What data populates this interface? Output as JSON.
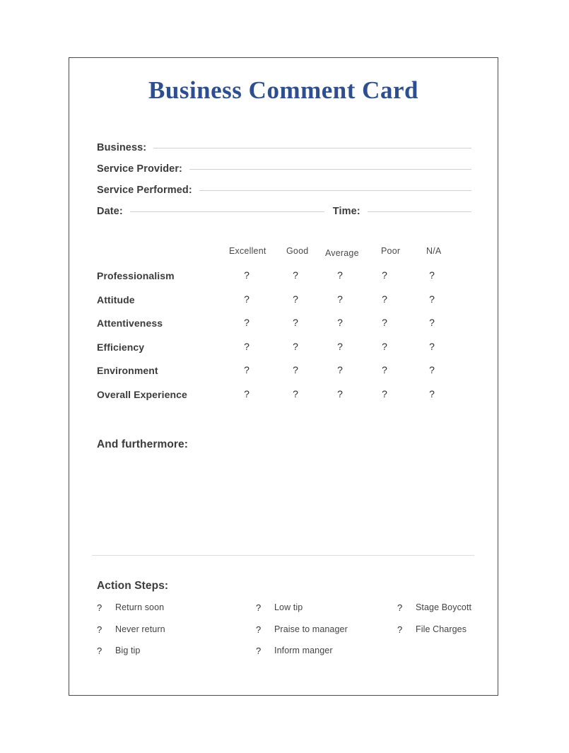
{
  "document": {
    "title": "Business Comment Card",
    "title_color": "#2e4f8f",
    "border_color": "#4a4a4a",
    "line_color": "#d2d2d2"
  },
  "form_fields": [
    {
      "label": "Business:"
    },
    {
      "label": "Service Provider:"
    },
    {
      "label": "Service Performed:"
    },
    {
      "label": "Date:",
      "second_label": "Time:"
    }
  ],
  "rating_table": {
    "columns": [
      "Excellent",
      "Good",
      "Average",
      "Poor",
      "N/A"
    ],
    "rows": [
      "Professionalism",
      "Attitude",
      "Attentiveness",
      "Efficiency",
      "Environment",
      "Overall Experience"
    ],
    "checkbox_glyph": "?"
  },
  "comments": {
    "heading": "And furthermore:",
    "value": "",
    "placeholder": ""
  },
  "action_steps": {
    "heading": "Action Steps:",
    "checkbox_glyph": "?",
    "columns": [
      [
        "Return soon",
        "Never return",
        "Big tip"
      ],
      [
        "Low tip",
        "Praise to manager",
        "Inform manger"
      ],
      [
        "Stage Boycott",
        "File Charges"
      ]
    ]
  }
}
